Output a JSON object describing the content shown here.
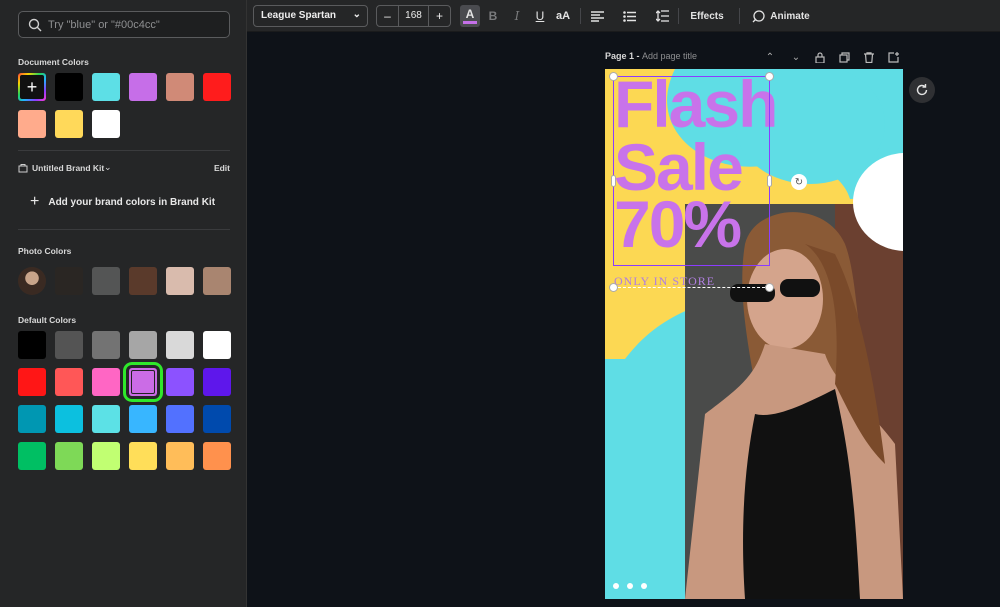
{
  "search": {
    "placeholder": "Try \"blue\" or \"#00c4cc\""
  },
  "document_colors": {
    "title": "Document Colors",
    "add_label": "+",
    "swatches": [
      "#000000",
      "#5ddfe6",
      "#c66ee8",
      "#d08a77",
      "#ff1c1c",
      "#ffab8c",
      "#ffd95a",
      "#ffffff"
    ]
  },
  "brand_kit": {
    "name": "Untitled Brand Kit",
    "edit_label": "Edit",
    "add_label": "Add your brand colors in Brand Kit"
  },
  "photo_colors": {
    "title": "Photo Colors",
    "swatches": [
      "#2a2623",
      "#545555",
      "#5a3a2b",
      "#d9bbad",
      "#a98570"
    ]
  },
  "default_colors": {
    "title": "Default Colors",
    "rows": [
      [
        "#000000",
        "#545454",
        "#737373",
        "#a6a6a6",
        "#d9d9d9",
        "#ffffff"
      ],
      [
        "#ff1616",
        "#ff5757",
        "#ff66c4",
        "#cb6ce6",
        "#8c52ff",
        "#5e17eb"
      ],
      [
        "#0097b2",
        "#0cc0df",
        "#5ce1e6",
        "#38b6ff",
        "#5271ff",
        "#004aad"
      ],
      [
        "#00bf63",
        "#7ed957",
        "#c1ff72",
        "#ffde59",
        "#ffbd59",
        "#ff914d"
      ]
    ],
    "selected": "#cb6ce6"
  },
  "toolbar": {
    "font": "League Spartan",
    "font_size": "168",
    "decrease": "–",
    "increase": "+",
    "text_color_label": "A",
    "bold_label": "B",
    "italic_label": "I",
    "underline_label": "U",
    "case_label": "aA",
    "effects_label": "Effects",
    "animate_label": "Animate",
    "text_color": "#c46fe8"
  },
  "page": {
    "label": "Page 1 -",
    "title_placeholder": "Add page title"
  },
  "design": {
    "line1": "Flash",
    "line2": "Sale",
    "line3": "70%",
    "subline": "ONLY IN STORE",
    "bg_color": "#5fdde5",
    "accent_yellow": "#fcd853",
    "text_color": "#c873ea"
  },
  "icons": {
    "search": "search-icon",
    "brand_kit": "brand-kit-icon",
    "align": "align-left-icon",
    "list": "list-icon",
    "spacing": "line-spacing-icon",
    "animate": "animate-icon",
    "chevron_up": "chevron-up-icon",
    "chevron_down": "chevron-down-icon",
    "lock": "lock-icon",
    "duplicate": "duplicate-icon",
    "trash": "trash-icon",
    "add_page": "add-page-icon",
    "regenerate": "regenerate-icon"
  }
}
